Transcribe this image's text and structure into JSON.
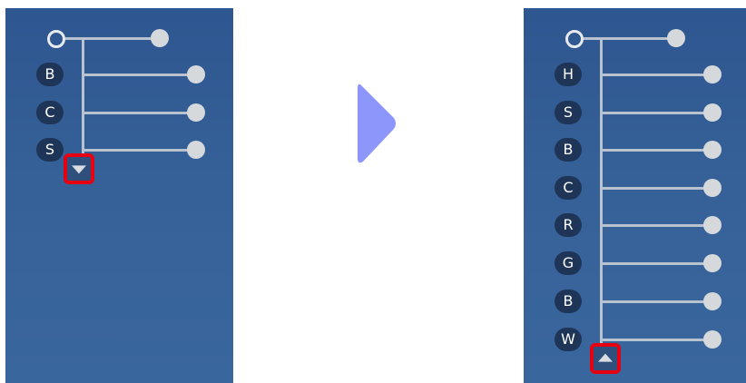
{
  "left_panel": {
    "chips": [
      "B",
      "C",
      "S"
    ],
    "expand_button_icon": "triangle-down-icon"
  },
  "right_panel": {
    "chips": [
      "H",
      "S",
      "B",
      "C",
      "R",
      "G",
      "B",
      "W"
    ],
    "collapse_button_icon": "triangle-up-icon"
  },
  "transition_icon": "play-right-icon",
  "colors": {
    "panel": "#355f97",
    "chip": "#1e3558",
    "highlight": "#e60012",
    "transition_arrow": "#8c96fb"
  }
}
